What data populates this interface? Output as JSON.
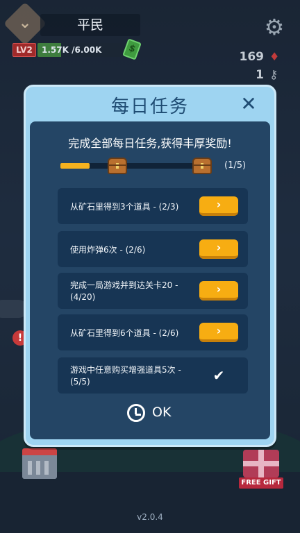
{
  "hud": {
    "rank_title": "平民",
    "level": "LV2",
    "xp_text": "1.57K /6.00K",
    "xp_progress": 0.26,
    "gem_count": "169",
    "key_count": "1",
    "version": "v2.0.4",
    "free_gift_label": "FREE GIFT"
  },
  "icons": {
    "rank": "rank-badge-icon",
    "cash": "cash-icon",
    "settings": "gear-icon",
    "gem": "gem-icon",
    "key": "key-icon",
    "shop": "shop-icon",
    "gift": "gift-icon",
    "alert": "alert-icon"
  },
  "modal": {
    "title": "每日任务",
    "close_symbol": "✕",
    "header": "完成全部每日任务,获得丰厚奖励!",
    "progress_text": "(1/5)",
    "progress_fraction": 0.2,
    "tasks": [
      {
        "label": "从矿石里得到3个道具 - (2/3)",
        "state": "go",
        "button": "›"
      },
      {
        "label": "使用炸弹6次 - (2/6)",
        "state": "go",
        "button": "›"
      },
      {
        "label": "完成一局游戏并到达关卡20 - (4/20)",
        "state": "go",
        "button": "›"
      },
      {
        "label": "从矿石里得到6个道具 - (2/6)",
        "state": "go",
        "button": "›"
      },
      {
        "label": "游戏中任意购买增强道具5次 - (5/5)",
        "state": "done",
        "button": "✔"
      }
    ],
    "ok_label": "OK"
  },
  "colors": {
    "modal_border": "#cde9f8",
    "modal_bg": "#9ed4f1",
    "panel_bg": "#244565",
    "task_bg": "#173554",
    "go_button": "#f7ad12",
    "progress_fill": "#f5b21f",
    "title_text": "#1f4c73"
  }
}
